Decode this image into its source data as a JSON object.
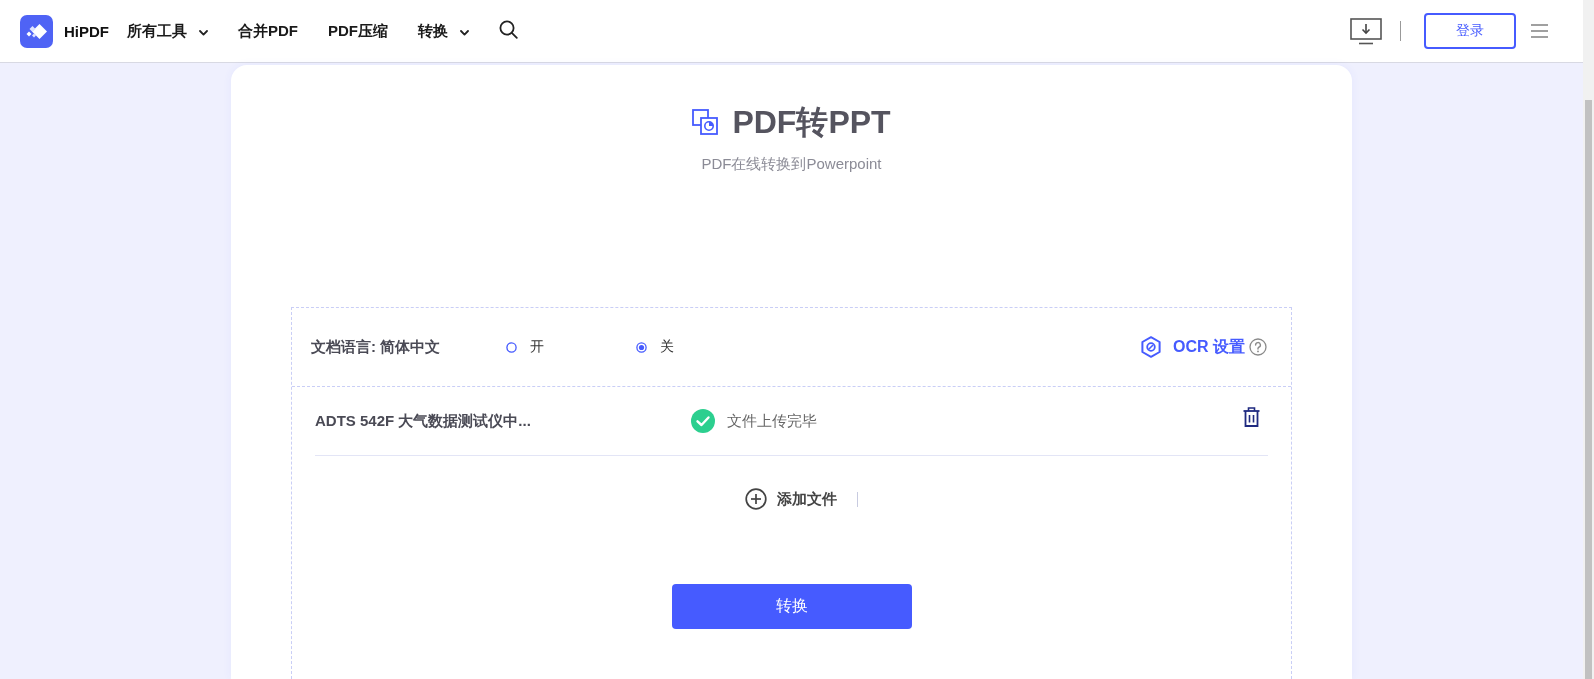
{
  "header": {
    "logo_text": "HiPDF",
    "nav": [
      {
        "label": "所有工具",
        "dropdown": true
      },
      {
        "label": "合并PDF",
        "dropdown": false
      },
      {
        "label": "PDF压缩",
        "dropdown": false
      },
      {
        "label": "转换",
        "dropdown": true
      }
    ],
    "login_button": "登录"
  },
  "tool": {
    "title": "PDF转PPT",
    "subtitle": "PDF在线转换到Powerpoint"
  },
  "options": {
    "language_label": "文档语言: **简体中文**",
    "ocr_options": [
      {
        "label": "开",
        "selected": false
      },
      {
        "label": "关",
        "selected": true
      }
    ],
    "ocr_settings": "OCR 设置"
  },
  "files": [
    {
      "name": "ADTS 542F 大气数据测试仪中...",
      "status": "文件上传完毕",
      "uploaded": true
    }
  ],
  "add_file": "添加文件",
  "convert_button": "转换"
}
